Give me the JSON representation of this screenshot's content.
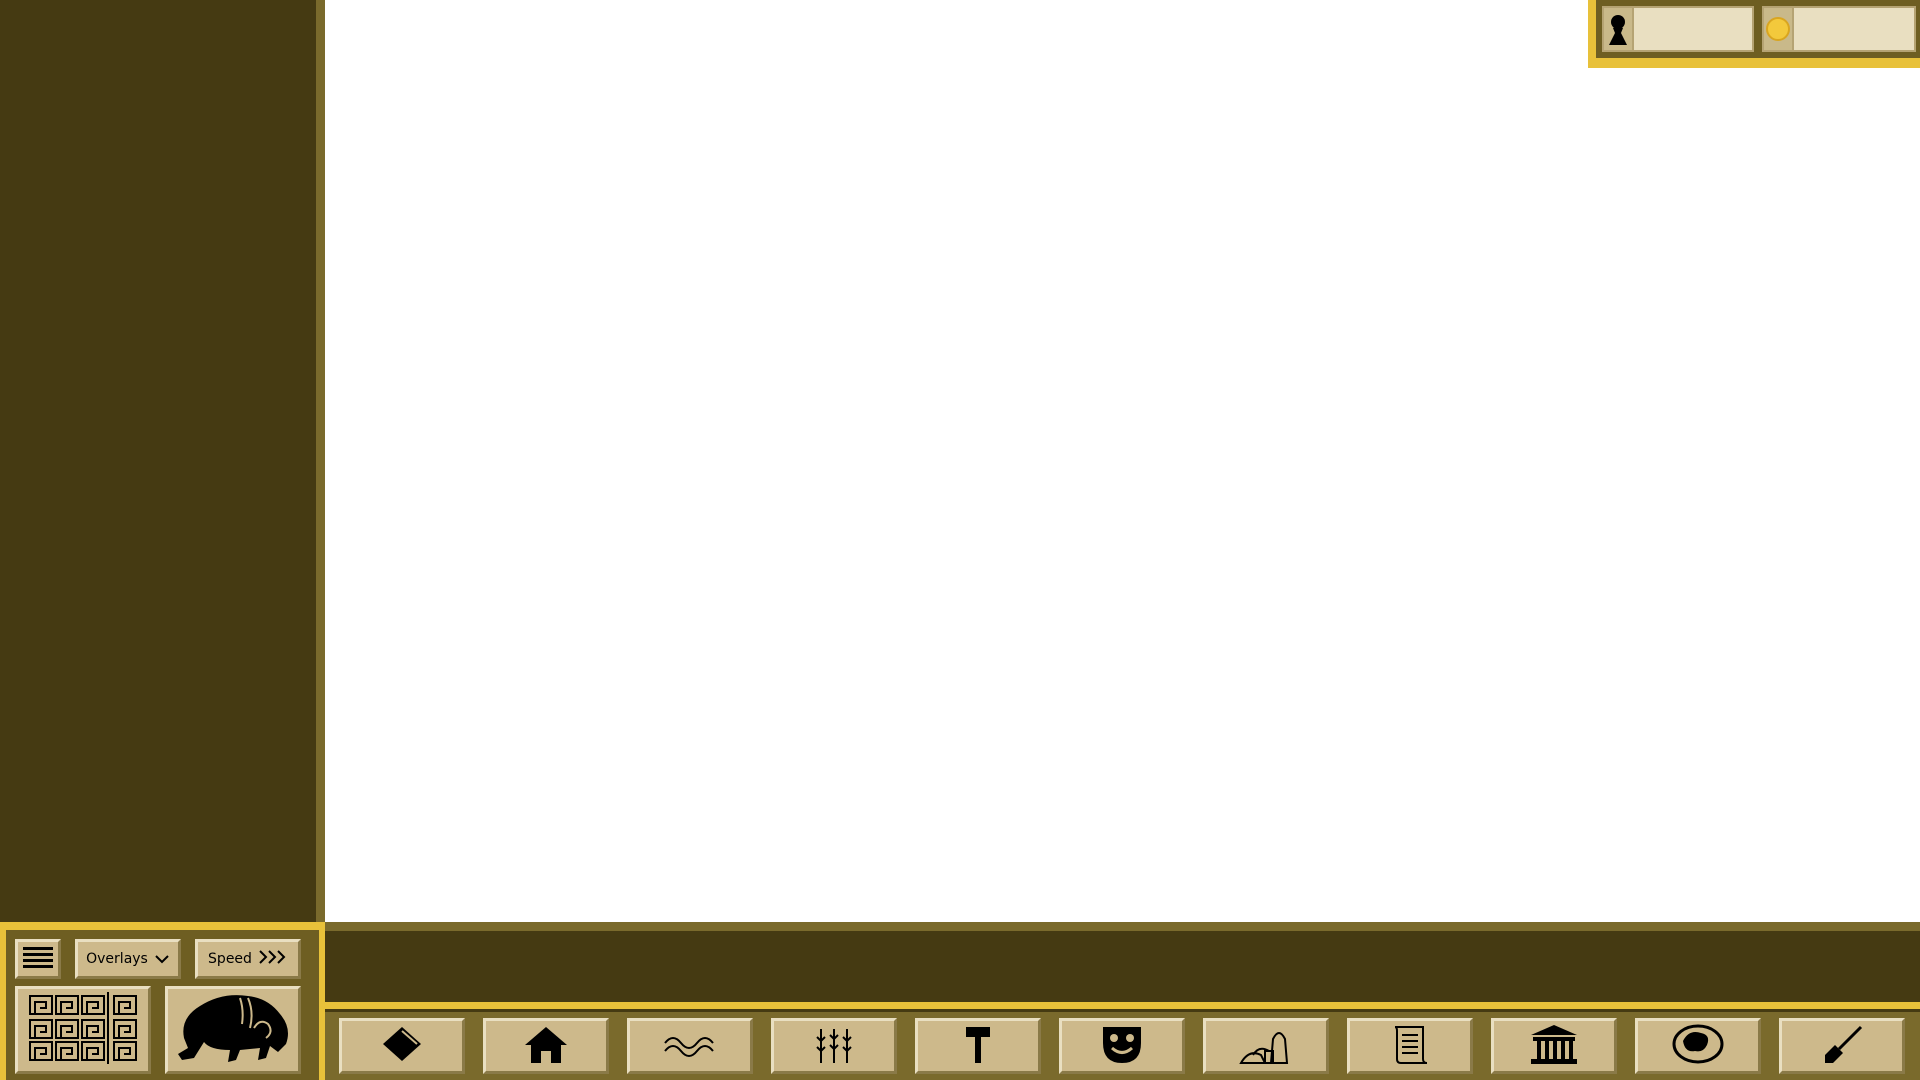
{
  "controls": {
    "menu_icon": "hamburger-menu-icon",
    "overlays_label": "Overlays",
    "overlays_icon": "chevron-down-icon",
    "speed_label": "Speed",
    "speed_icon": "fast-forward-chevrons-icon",
    "minimap_icon": "city-minimap-icon",
    "empire_icon": "bull-emblem-icon"
  },
  "resources": {
    "population": {
      "icon": "person-silhouette-icon",
      "value": ""
    },
    "money": {
      "icon": "gold-coin-icon",
      "value": ""
    }
  },
  "message_bar": {
    "text": ""
  },
  "build_menu": [
    {
      "id": "clear-land",
      "icon": "diamond-icon"
    },
    {
      "id": "housing",
      "icon": "house-icon"
    },
    {
      "id": "water",
      "icon": "waves-icon"
    },
    {
      "id": "agriculture",
      "icon": "wheat-stalks-icon"
    },
    {
      "id": "industry",
      "icon": "hammer-icon"
    },
    {
      "id": "entertainment",
      "icon": "theater-mask-icon"
    },
    {
      "id": "commerce",
      "icon": "goods-sacks-icon"
    },
    {
      "id": "administration",
      "icon": "scroll-icon"
    },
    {
      "id": "religion",
      "icon": "temple-icon"
    },
    {
      "id": "world-map",
      "icon": "globe-icon"
    },
    {
      "id": "dig",
      "icon": "shovel-icon"
    }
  ],
  "colors": {
    "panel_dark": "#453a12",
    "panel_mid": "#7a6a2c",
    "gold": "#e8c13a",
    "button_face": "#cdb98b",
    "field_bg": "#e9dfc1"
  }
}
